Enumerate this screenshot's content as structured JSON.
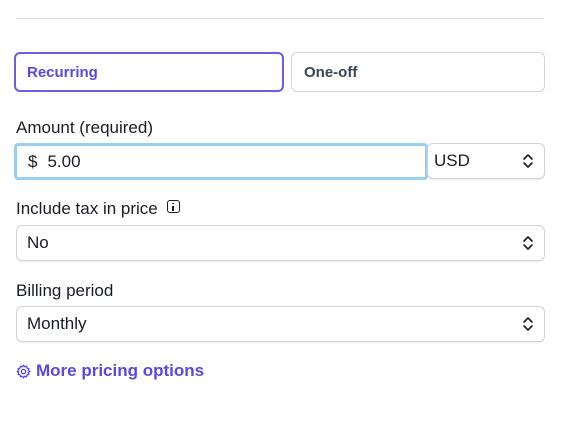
{
  "price_type": {
    "recurring_label": "Recurring",
    "oneoff_label": "One-off",
    "selected": "Recurring"
  },
  "amount": {
    "label": "Amount (required)",
    "currency_symbol": "$",
    "value": "5.00",
    "currency": "USD"
  },
  "tax": {
    "label": "Include tax in price",
    "value": "No"
  },
  "billing": {
    "label": "Billing period",
    "value": "Monthly"
  },
  "more_options": {
    "label": "More pricing options"
  },
  "colors": {
    "accent": "#5a48e0",
    "focus_ring": "#9ccef0",
    "border": "#d2d4db"
  },
  "icons": [
    "info-icon",
    "chevron-updown-icon",
    "gear-icon"
  ]
}
